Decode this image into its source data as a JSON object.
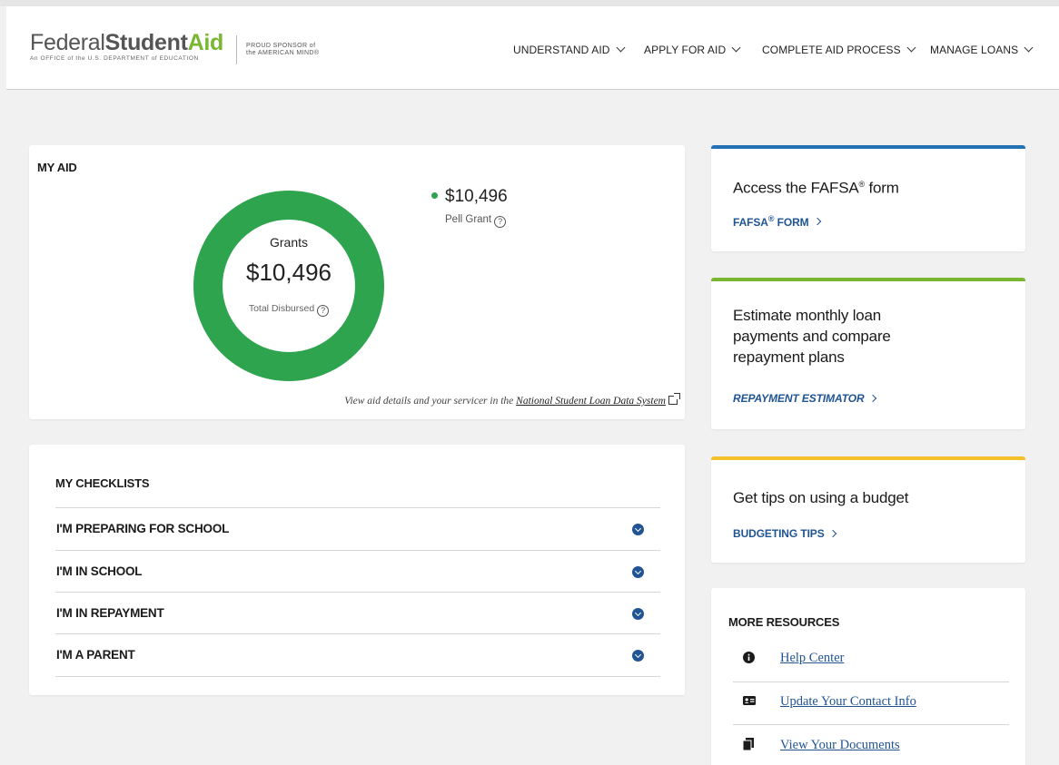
{
  "header": {
    "logo": {
      "federal": "Federal",
      "student": "Student",
      "aid": "Aid",
      "subtitle": "An OFFICE of the U.S. DEPARTMENT of EDUCATION"
    },
    "sponsor": {
      "line1": "PROUD SPONSOR of",
      "line2": "the AMERICAN MIND®"
    },
    "nav": [
      {
        "label": "UNDERSTAND AID"
      },
      {
        "label": "APPLY FOR AID"
      },
      {
        "label": "COMPLETE AID PROCESS"
      },
      {
        "label": "MANAGE LOANS"
      }
    ]
  },
  "my_aid": {
    "title": "MY AID",
    "donut": {
      "category": "Grants",
      "amount": "$10,496",
      "label": "Total Disbursed"
    },
    "legend": {
      "amount": "$10,496",
      "name": "Pell Grant",
      "color": "#2ea44f"
    },
    "footer_text": "View aid details and your servicer in the",
    "footer_link": "National Student Loan Data System"
  },
  "checklists": {
    "title": "MY CHECKLISTS",
    "items": [
      {
        "label": "I'M PREPARING FOR SCHOOL"
      },
      {
        "label": "I'M IN SCHOOL"
      },
      {
        "label": "I'M IN REPAYMENT"
      },
      {
        "label": "I'M A PARENT"
      }
    ]
  },
  "side_cards": [
    {
      "heading_pre": "Access the FAFSA",
      "heading_post": " form",
      "link_pre": "FAFSA",
      "link_post": " FORM",
      "accent": "#2372b6"
    },
    {
      "heading": "Estimate monthly loan payments and compare repayment plans",
      "link": "REPAYMENT ESTIMATOR",
      "accent": "#7ab630"
    },
    {
      "heading": "Get tips on using a budget",
      "link": "BUDGETING TIPS",
      "accent": "#f4c12c"
    }
  ],
  "resources": {
    "title": "MORE RESOURCES",
    "items": [
      {
        "label": "Help Center",
        "icon": "info-icon"
      },
      {
        "label": "Update Your Contact Info",
        "icon": "contact-card-icon"
      },
      {
        "label": "View Your Documents",
        "icon": "documents-icon"
      }
    ]
  },
  "colors": {
    "brand_blue": "#205493",
    "grant_green": "#2ea44f",
    "logo_green": "#7ab630"
  }
}
